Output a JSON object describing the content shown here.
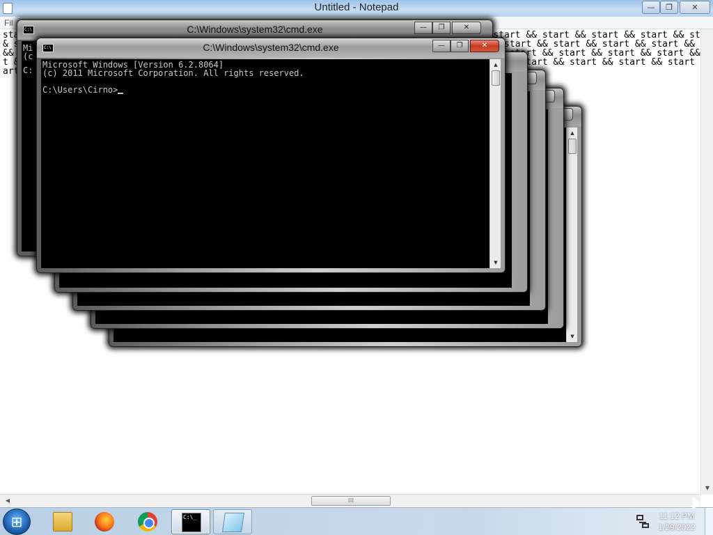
{
  "notepad": {
    "title": "Untitled - Notepad",
    "menu_first": "Fil",
    "text_lines": [
      "start && start && start && start && start && start && start && start && start && start && start && start && start && start && start && start && start && start && start && start &&",
      "& start && start && start && start && start && start && start && start && start && start && start && start && start && start && start && start && start && start && start && start",
      "&& start && start && start && start && start && start && start && start && start && start && start && start && start && start && start && start && start && start && start && start",
      "t && start && start && start && start && start && start && start && start && start && start && start && start && start && start && start && start && start && start && start && sta",
      "art"
    ],
    "scroll_thumb_label": "⁞⁞⁞"
  },
  "cmd": {
    "title": "C:\\Windows\\system32\\cmd.exe",
    "icon_text": "C:\\",
    "line1": "Microsoft Windows [Version 6.2.8064]",
    "line2": "(c) 2011 Microsoft Corporation. All rights reserved.",
    "prompt": "C:\\Users\\Cirno>",
    "back_fragments": [
      "Mi",
      "(c",
      "C:"
    ]
  },
  "window_buttons": {
    "minimize": "—",
    "maximize": "❐",
    "close": "✕"
  },
  "taskbar": {
    "start_icon": "start-orb-icon",
    "pinned": [
      "file-explorer-icon",
      "firefox-icon",
      "chrome-icon",
      "command-prompt-icon",
      "notepad-icon"
    ],
    "cmd_icon_text": "C:\\_",
    "clock_time": "11:12 PM",
    "clock_date": "1/29/2022"
  },
  "colors": {
    "console_bg": "#000000",
    "console_text": "#c8c8c8",
    "aero_glass": "#a9a9a9",
    "close_red": "#c43b23"
  }
}
